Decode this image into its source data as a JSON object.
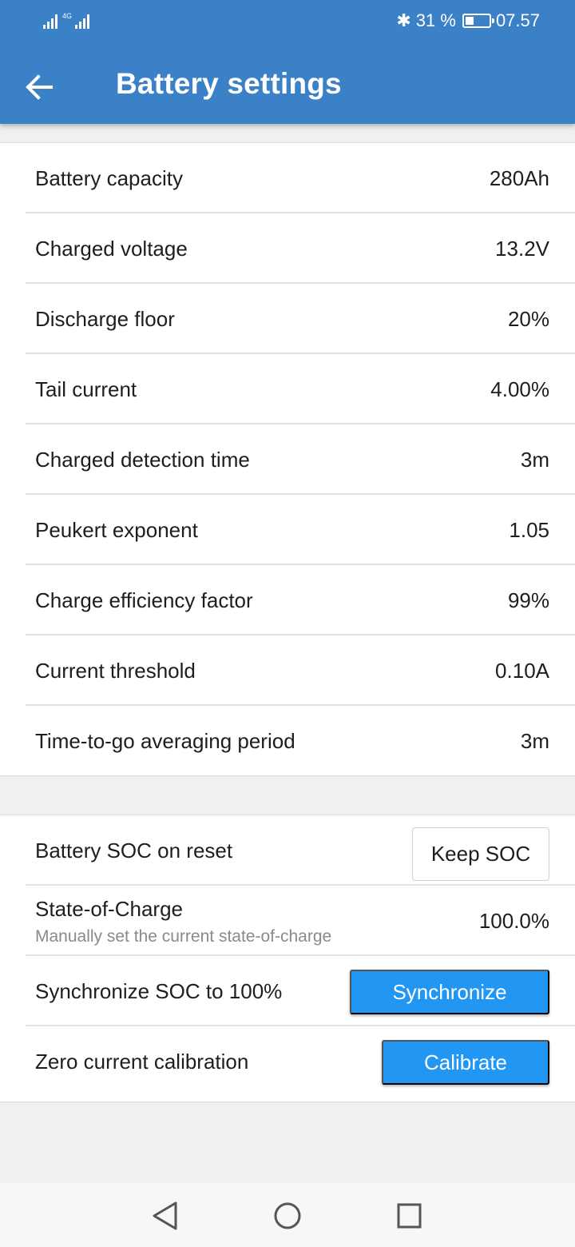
{
  "status_bar": {
    "network_label": "4G",
    "battery_percent": "31 %",
    "time": "07.57",
    "bluetooth_glyph": "✱"
  },
  "header": {
    "title": "Battery settings",
    "back_icon": "arrow-left-icon",
    "background_color": "#3b81c8"
  },
  "settings": [
    {
      "label": "Battery capacity",
      "value": "280Ah"
    },
    {
      "label": "Charged voltage",
      "value": "13.2V"
    },
    {
      "label": "Discharge floor",
      "value": "20%"
    },
    {
      "label": "Tail current",
      "value": "4.00%"
    },
    {
      "label": "Charged detection time",
      "value": "3m"
    },
    {
      "label": "Peukert exponent",
      "value": "1.05"
    },
    {
      "label": "Charge efficiency factor",
      "value": "99%"
    },
    {
      "label": "Current threshold",
      "value": "0.10A"
    },
    {
      "label": "Time-to-go averaging period",
      "value": "3m"
    }
  ],
  "soc_section": {
    "soc_on_reset": {
      "label": "Battery SOC on reset",
      "button_label": "Keep SOC"
    },
    "state_of_charge": {
      "label": "State-of-Charge",
      "sublabel": "Manually set the current state-of-charge",
      "value": "100.0%"
    },
    "synchronize": {
      "label": "Synchronize SOC to 100%",
      "button_label": "Synchronize"
    },
    "calibrate": {
      "label": "Zero current calibration",
      "button_label": "Calibrate"
    },
    "button_color": "#2196f3"
  },
  "nav_bar": {
    "back": "triangle-back-icon",
    "home": "circle-home-icon",
    "recents": "square-recents-icon"
  }
}
